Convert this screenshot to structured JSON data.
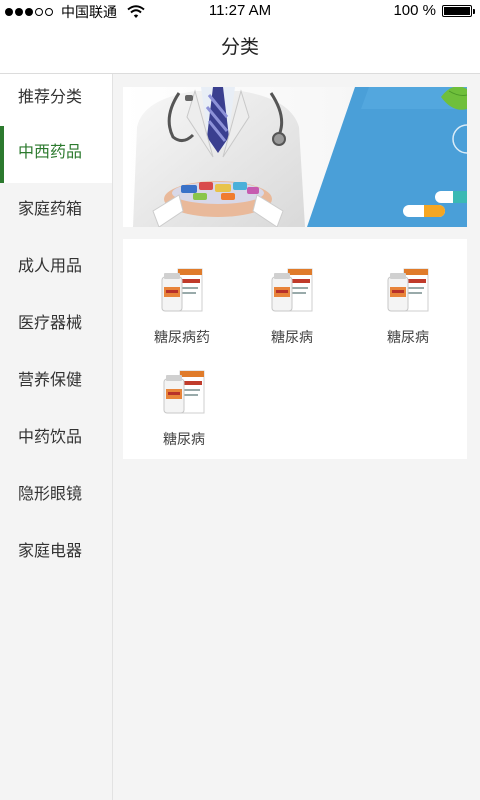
{
  "status_bar": {
    "carrier": "中国联通",
    "time": "11:27 AM",
    "battery": "100 %",
    "battery_level": 1.0,
    "signal_bars_filled": 3,
    "signal_bars_total": 5
  },
  "nav": {
    "title": "分类"
  },
  "sidebar": {
    "items": [
      {
        "label": "推荐分类"
      },
      {
        "label": "中西药品",
        "active": true
      },
      {
        "label": "家庭药箱"
      },
      {
        "label": "成人用品"
      },
      {
        "label": "医疗器械"
      },
      {
        "label": "营养保健"
      },
      {
        "label": "中药饮品"
      },
      {
        "label": "隐形眼镜"
      },
      {
        "label": "家庭电器"
      }
    ]
  },
  "products": [
    {
      "label": "糖尿病药"
    },
    {
      "label": "糖尿病"
    },
    {
      "label": "糖尿病"
    },
    {
      "label": "糖尿病"
    }
  ],
  "colors": {
    "accent_green": "#2c7a2e",
    "banner_blue": "#4a9fd8",
    "sidebar_bg": "#f4f4f4"
  }
}
